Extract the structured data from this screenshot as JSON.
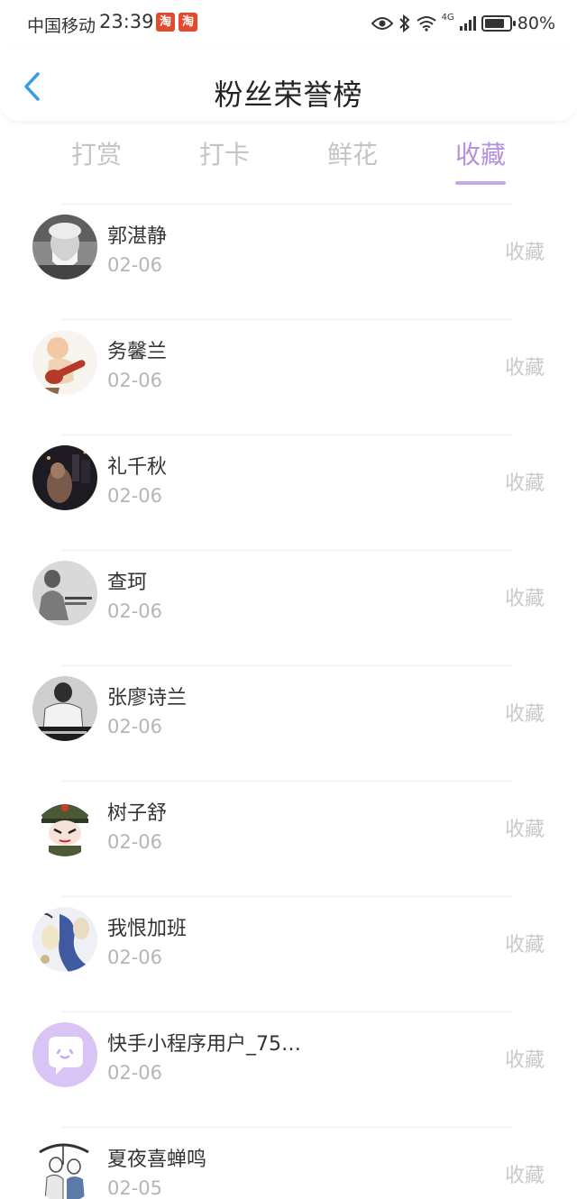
{
  "status_bar": {
    "carrier": "中国移动",
    "time": "23:39",
    "app_badge": "淘",
    "network": "4G",
    "battery_percent": "80%",
    "battery_level": 0.8
  },
  "header": {
    "title": "粉丝荣誉榜"
  },
  "tabs": [
    {
      "label": "打赏",
      "active": false
    },
    {
      "label": "打卡",
      "active": false
    },
    {
      "label": "鲜花",
      "active": false
    },
    {
      "label": "收藏",
      "active": true
    }
  ],
  "colors": {
    "accent": "#b68ede",
    "back_icon": "#3a9ee4",
    "default_avatar_bg": "#d9c4f5"
  },
  "fans": [
    {
      "name": "郭湛静",
      "date": "02-06",
      "action": "收藏",
      "avatar": "avatar-portrait-icon"
    },
    {
      "name": "务馨兰",
      "date": "02-06",
      "action": "收藏",
      "avatar": "avatar-cartoon-guitar-icon"
    },
    {
      "name": "礼千秋",
      "date": "02-06",
      "action": "收藏",
      "avatar": "avatar-dark-photo-icon"
    },
    {
      "name": "查珂",
      "date": "02-06",
      "action": "收藏",
      "avatar": "avatar-grey-photo-icon"
    },
    {
      "name": "张廖诗兰",
      "date": "02-06",
      "action": "收藏",
      "avatar": "avatar-bw-photo-icon"
    },
    {
      "name": "树子舒",
      "date": "02-06",
      "action": "收藏",
      "avatar": "avatar-cartoon-soldier-icon"
    },
    {
      "name": "我恨加班",
      "date": "02-06",
      "action": "收藏",
      "avatar": "avatar-illustration-icon"
    },
    {
      "name": "快手小程序用户_75…",
      "date": "02-06",
      "action": "收藏",
      "avatar": "avatar-default-chat-icon"
    },
    {
      "name": "夏夜喜蝉鸣",
      "date": "02-05",
      "action": "收藏",
      "avatar": "avatar-sketch-icon"
    }
  ]
}
